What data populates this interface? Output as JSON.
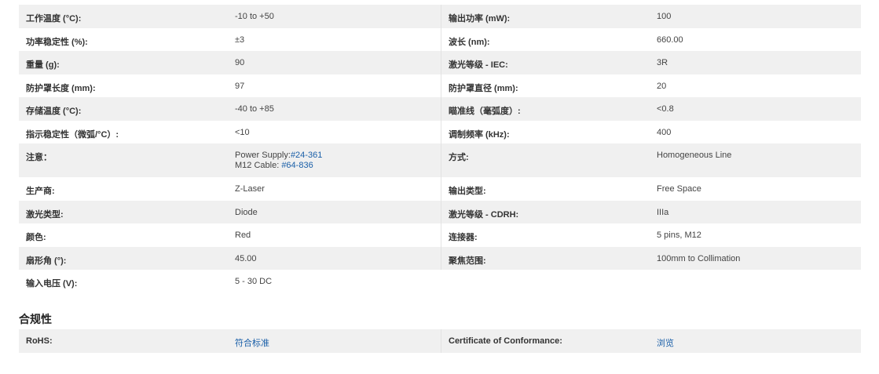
{
  "specs": [
    {
      "k1": "工作温度 (°C):",
      "v1": "-10 to +50",
      "k2": "输出功率 (mW):",
      "v2": "100"
    },
    {
      "k1": "功率稳定性 (%):",
      "v1": "±3",
      "k2": "波长 (nm):",
      "v2": "660.00"
    },
    {
      "k1": "重量 (g):",
      "v1": "90",
      "k2": "激光等级 - IEC:",
      "v2": "3R"
    },
    {
      "k1": "防护罩长度 (mm):",
      "v1": "97",
      "k2": "防护罩直径 (mm):",
      "v2": "20"
    },
    {
      "k1": "存储温度 (°C):",
      "v1": "-40 to +85",
      "k2": "瞄准线（毫弧度）:",
      "v2": "<0.8"
    },
    {
      "k1": "指示稳定性（微弧/°C）:",
      "v1": "<10",
      "k2": "调制频率 (kHz):",
      "v2": "400"
    },
    {
      "k1": "注意：",
      "v1_line1_prefix": "Power Supply:",
      "v1_line1_link": "#24-361",
      "v1_line2_prefix": "M12 Cable: ",
      "v1_line2_link": "#64-836",
      "k2": "方式:",
      "v2": "Homogeneous Line"
    },
    {
      "k1": "生产商:",
      "v1": "Z-Laser",
      "k2": "输出类型:",
      "v2": "Free Space"
    },
    {
      "k1": "激光类型:",
      "v1": "Diode",
      "k2": "激光等级 - CDRH:",
      "v2": "IIIa"
    },
    {
      "k1": "颜色:",
      "v1": "Red",
      "k2": "连接器:",
      "v2": "5 pins, M12"
    },
    {
      "k1": "扇形角 (°):",
      "v1": "45.00",
      "k2": "聚焦范围:",
      "v2": "100mm to Collimation"
    },
    {
      "k1": "输入电压 (V):",
      "v1": "5 - 30 DC",
      "k2": "",
      "v2": ""
    }
  ],
  "compliance": {
    "title": "合规性",
    "rohs_label": "RoHS:",
    "rohs_link": "符合标准",
    "cert_label": "Certificate of Conformance:",
    "cert_link": "浏览"
  },
  "colors": {
    "stripe": "#f0f0f0",
    "link": "#1a5fa8",
    "divider": "#e3e3e3"
  }
}
